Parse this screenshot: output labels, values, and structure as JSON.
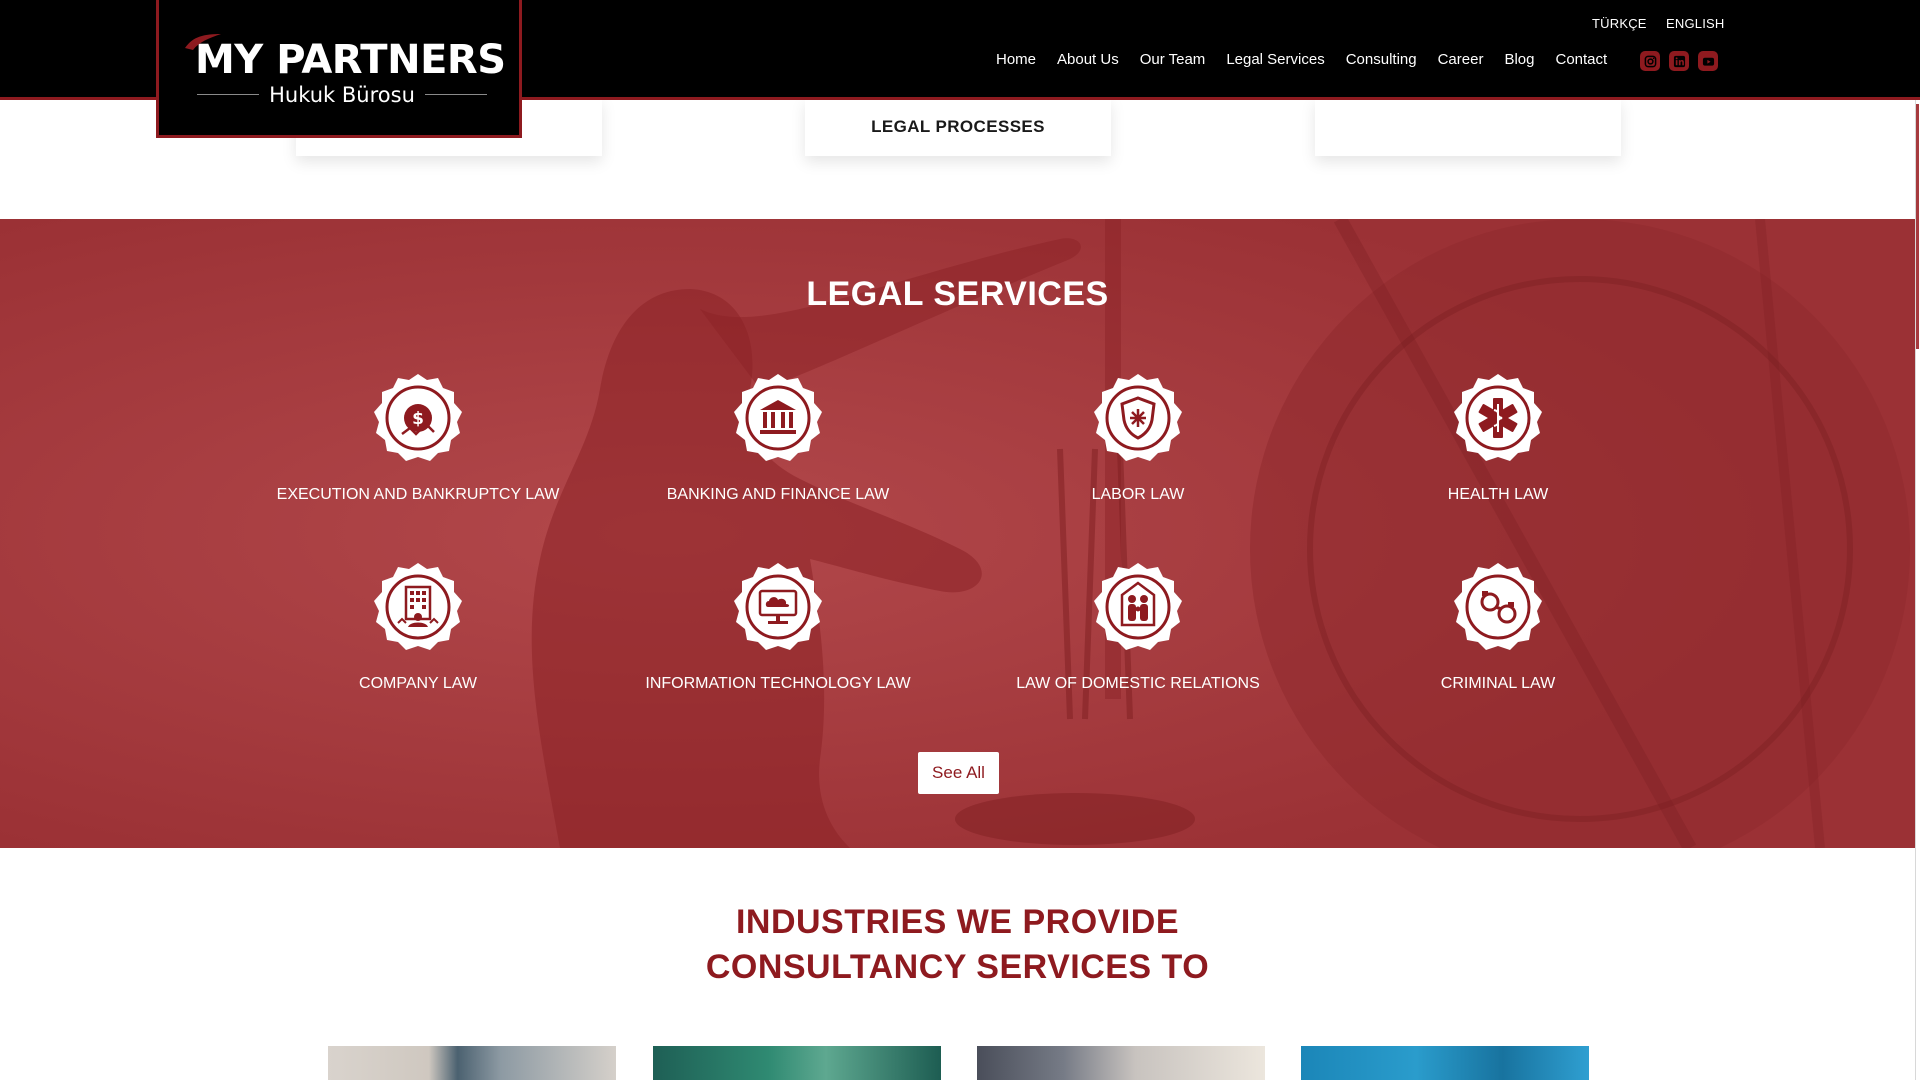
{
  "header": {
    "brand_main": "MY PARTNERS",
    "brand_sub": "Hukuk Bürosu",
    "languages": [
      "TÜRKÇE",
      "ENGLISH"
    ],
    "nav": [
      "Home",
      "About Us",
      "Our Team",
      "Legal Services",
      "Consulting",
      "Career",
      "Blog",
      "Contact"
    ],
    "social": [
      {
        "icon": "instagram-icon"
      },
      {
        "icon": "linkedin-icon"
      },
      {
        "icon": "youtube-icon"
      }
    ]
  },
  "cards": [
    {
      "label": ""
    },
    {
      "label": "LEGAL PROCESSES"
    },
    {
      "label": ""
    }
  ],
  "legal_services": {
    "title": "LEGAL SERVICES",
    "items": [
      {
        "label": "EXECUTION AND BANKRUPTCY LAW",
        "icon": "dollar-icon"
      },
      {
        "label": "BANKING AND FINANCE LAW",
        "icon": "bank-icon"
      },
      {
        "label": "LABOR LAW",
        "icon": "shield-icon"
      },
      {
        "label": "HEALTH LAW",
        "icon": "medical-icon"
      },
      {
        "label": "COMPANY LAW",
        "icon": "building-icon"
      },
      {
        "label": "INFORMATION TECHNOLOGY LAW",
        "icon": "cloud-computer-icon"
      },
      {
        "label": "LAW OF DOMESTIC RELATIONS",
        "icon": "family-icon"
      },
      {
        "label": "CRIMINAL LAW",
        "icon": "handcuffs-icon"
      }
    ],
    "see_all": "See All"
  },
  "industries": {
    "title_line1": "INDUSTRIES WE PROVIDE",
    "title_line2": "CONSULTANCY SERVICES TO"
  },
  "colors": {
    "brand_red": "#8e1a1f",
    "section_red": "#a63a3e",
    "header_black": "#000000"
  }
}
